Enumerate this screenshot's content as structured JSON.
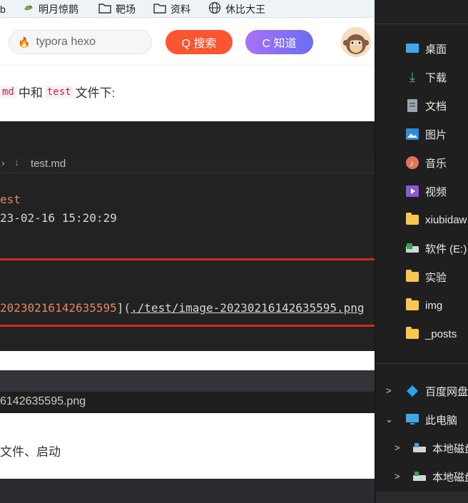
{
  "bookmarks": [
    {
      "label": "b",
      "icon": ""
    },
    {
      "label": "明月惊鹊",
      "icon": "bird-icon"
    },
    {
      "label": "靶场",
      "icon": "folder-icon"
    },
    {
      "label": "资料",
      "icon": "folder-icon"
    },
    {
      "label": "休比大王",
      "icon": "globe-icon"
    }
  ],
  "search": {
    "value": "typora hexo"
  },
  "buttons": {
    "search": "Q 搜索",
    "zhidao": "C 知道"
  },
  "article": {
    "line1_code1": "md",
    "line1_text1": "中和",
    "line1_code2": "test",
    "line1_text2": "文件下:",
    "tab_label": "test.md",
    "code_title": "est",
    "code_date": "23-02-16 15:20:29",
    "code_image_prefix": "20230216142635595",
    "code_image_sep": "](",
    "code_image_path": "./test/image-20230216142635595.png",
    "file_label": "6142635595.png",
    "final_text": "文件、启动"
  },
  "explorer": {
    "items": [
      "桌面",
      "下载",
      "文档",
      "图片",
      "音乐",
      "视频",
      "xiubidaw",
      "软件 (E:)",
      "实验",
      "img",
      "_posts"
    ],
    "tree": [
      "百度网盘",
      "此电脑",
      "本地磁盘",
      "本地磁盘"
    ]
  },
  "colors": {
    "accent_red": "#fc5531",
    "rule_red": "#d42b18",
    "folder_yellow": "#f8c94a"
  }
}
